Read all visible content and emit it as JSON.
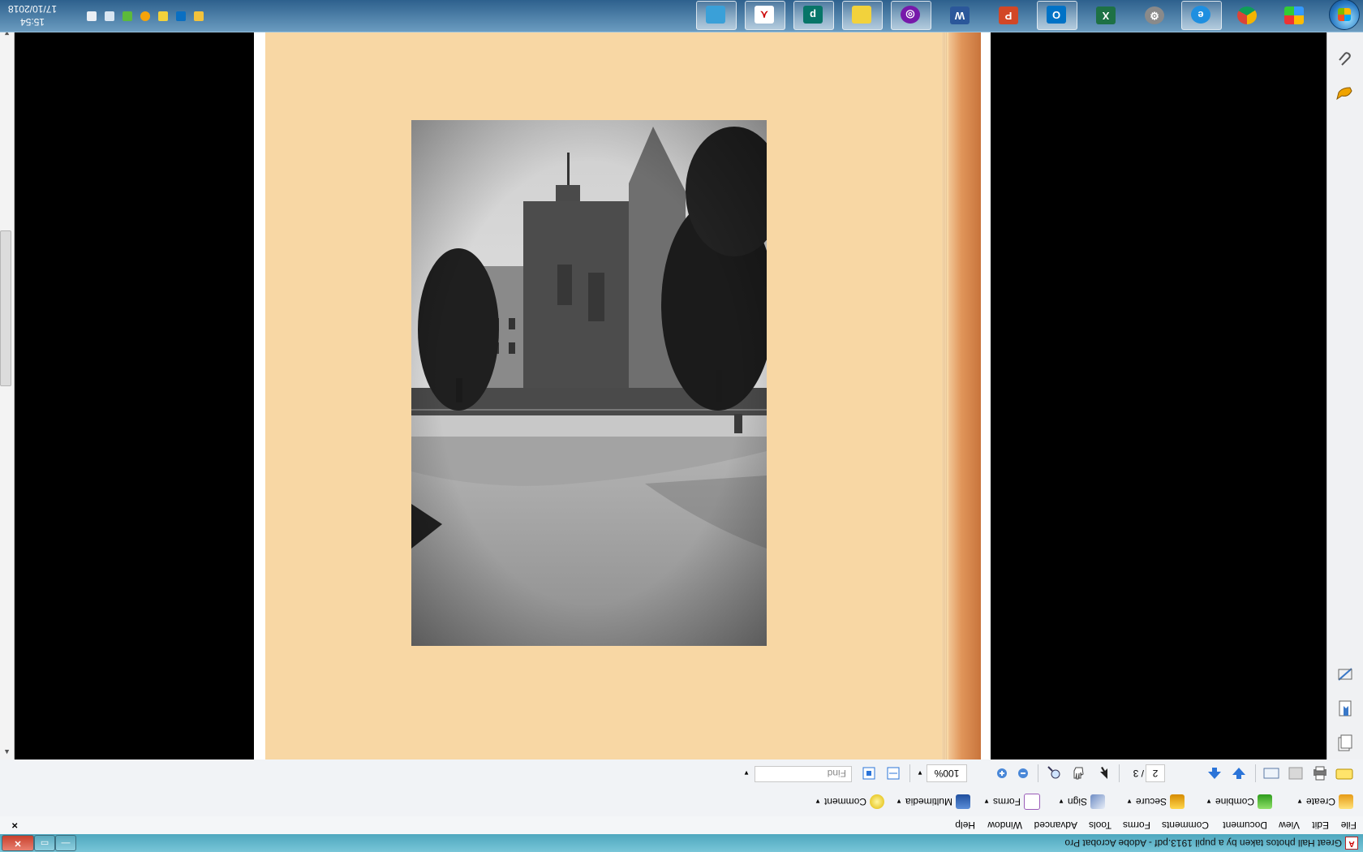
{
  "window": {
    "title": "Great Hall photos taken by a pupil 1913.pdf - Adobe Acrobat Pro",
    "controls": {
      "minimize": "—",
      "maximize": "▭",
      "close": "✕"
    }
  },
  "menubar": {
    "items": [
      "File",
      "Edit",
      "View",
      "Document",
      "Comments",
      "Forms",
      "Tools",
      "Advanced",
      "Window",
      "Help"
    ],
    "close": "×"
  },
  "tasks": [
    {
      "label": "Create"
    },
    {
      "label": "Combine"
    },
    {
      "label": "Secure"
    },
    {
      "label": "Sign"
    },
    {
      "label": "Forms"
    },
    {
      "label": "Multimedia"
    },
    {
      "label": "Comment"
    }
  ],
  "toolbar": {
    "page_current": "2",
    "page_total": "/ 3",
    "zoom": "100%",
    "find_placeholder": "Find"
  },
  "taskbar": {
    "clock_time": "15:54",
    "clock_date": "17/10/2018",
    "apps": [
      "ie-icon",
      "chrome-icon",
      "apps-icon",
      "settings-icon",
      "excel-icon",
      "outlook-icon",
      "powerpoint-icon",
      "word-icon",
      "onenote-icon",
      "files-icon",
      "publisher-icon",
      "acrobat-icon",
      "photos-icon"
    ],
    "tray_icons": [
      "photo-tray-icon",
      "outlook-tray-icon",
      "notes-tray-icon",
      "update-tray-icon",
      "network-tray-icon",
      "display-tray-icon",
      "volume-tray-icon"
    ]
  },
  "colors": {
    "page_background": "#f8d7a4",
    "document_background": "#000000",
    "title_bar": "#4ea7be"
  }
}
